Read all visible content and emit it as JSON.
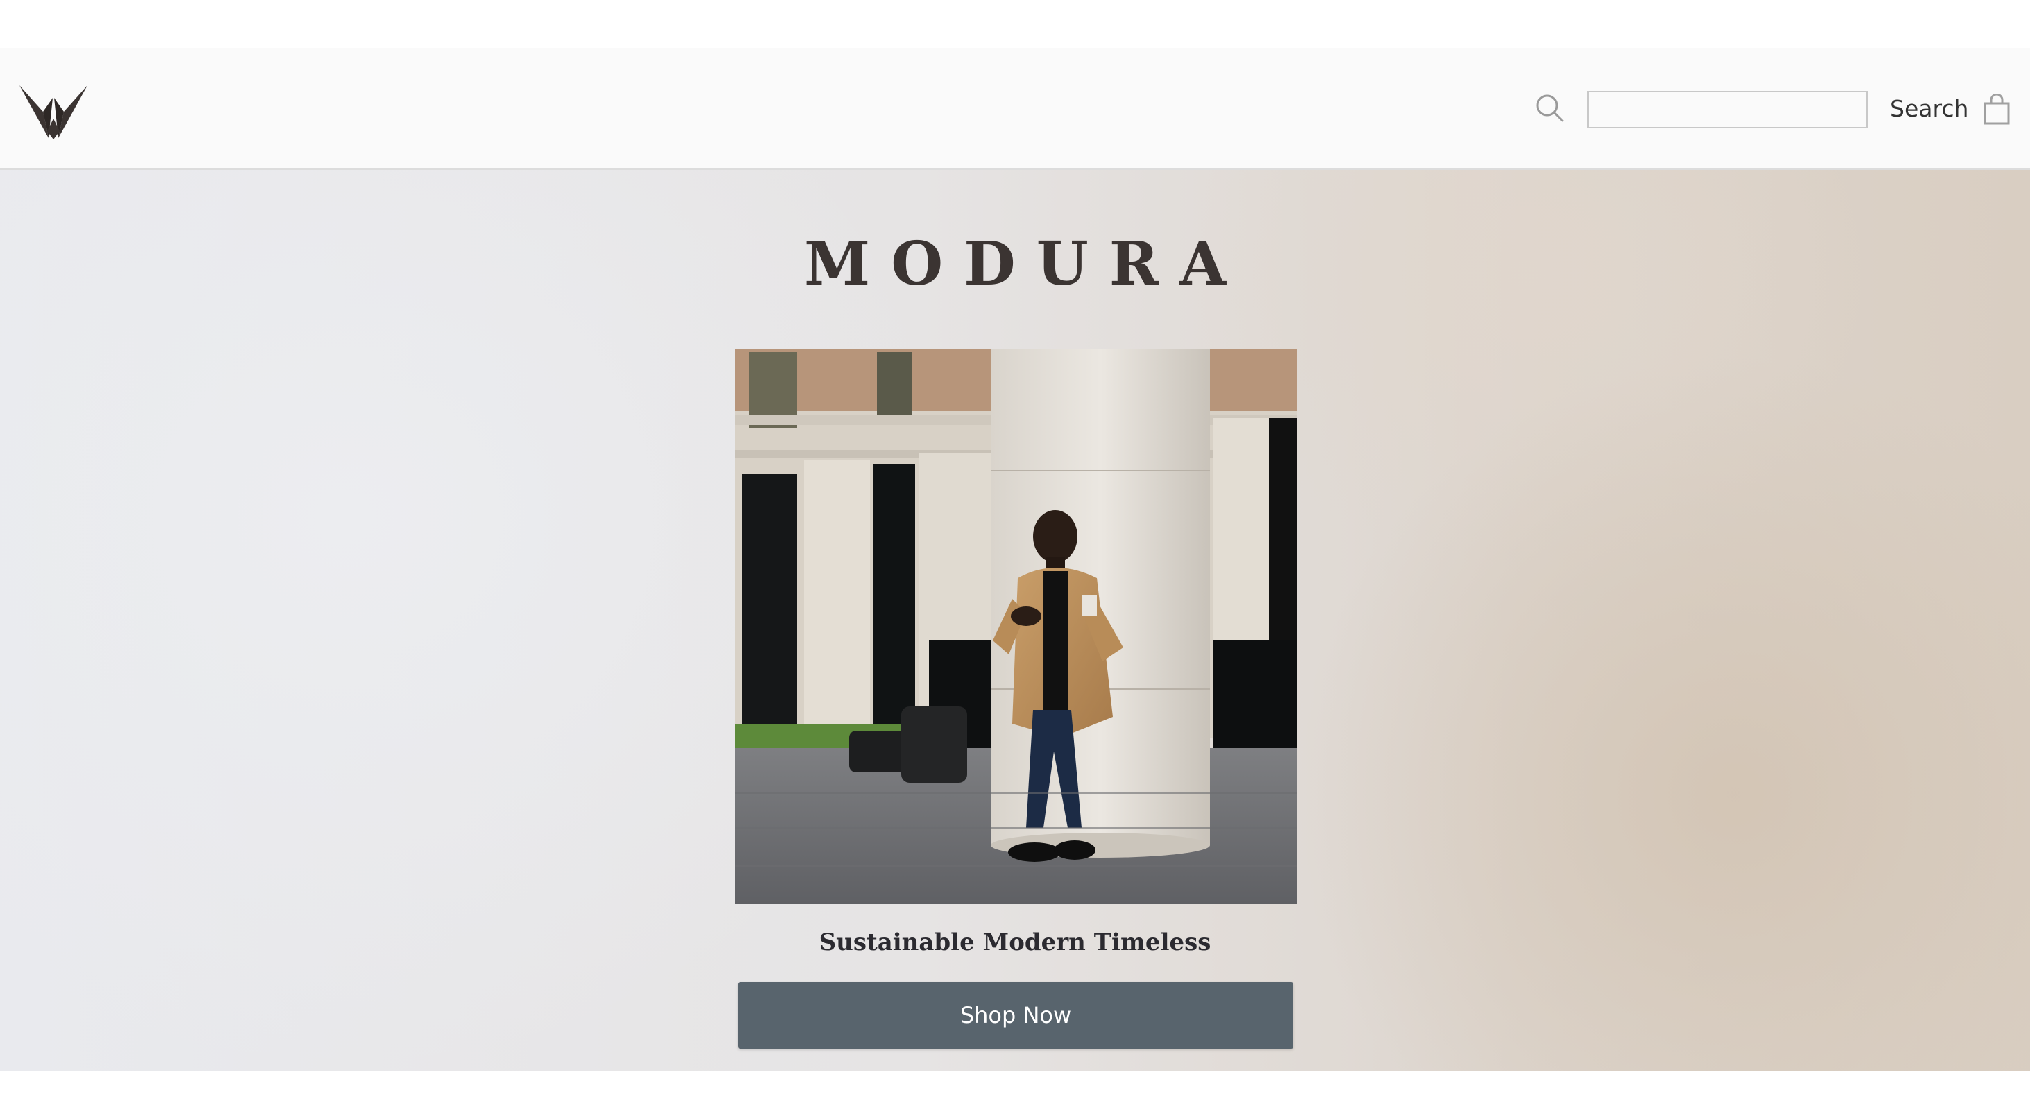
{
  "header": {
    "logo_icon": "v-logo-icon",
    "search_icon": "search-icon",
    "search_input_value": "",
    "search_input_placeholder": "",
    "search_label": "Search",
    "cart_icon": "shopping-bag-icon"
  },
  "hero": {
    "brand_name": "MODURA",
    "image_subject": "man-in-camel-coat-leaning-on-column-photo",
    "tagline": "Sustainable Modern Timeless",
    "cta_label": "Shop Now"
  },
  "colors": {
    "brand_text": "#3b3432",
    "button_bg": "#58646d",
    "header_bg": "#fafafa"
  }
}
